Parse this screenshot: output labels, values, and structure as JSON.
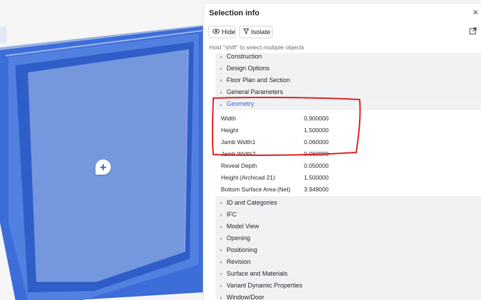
{
  "panel": {
    "title": "Selection info",
    "close_glyph": "×",
    "hide_label": "Hide",
    "isolate_label": "Isolate",
    "hint": "Hold \"shift\" to select multiple objects",
    "icons": {
      "hide": "eye-icon",
      "isolate": "filter-icon",
      "external": "external-link-icon",
      "close": "close-icon",
      "marker": "add-comment-icon"
    }
  },
  "groups_before": [
    {
      "label": "Construction"
    },
    {
      "label": "Design Options"
    },
    {
      "label": "Floor Plan and Section"
    },
    {
      "label": "General Parameters"
    }
  ],
  "geometry": {
    "label": "Geometry",
    "rows": [
      {
        "key": "Width",
        "value": "0.900000"
      },
      {
        "key": "Height",
        "value": "1.500000"
      },
      {
        "key": "Jamb Width1",
        "value": "0.060000"
      },
      {
        "key": "Jamb Width2",
        "value": "0.060000"
      },
      {
        "key": "Reveal Depth",
        "value": "0.050000"
      },
      {
        "key": "Height (Archicad 21)",
        "value": "1.500000"
      },
      {
        "key": "Bottom Surface Area (Net)",
        "value": "3.949000"
      }
    ]
  },
  "groups_after": [
    {
      "label": "ID and Categories"
    },
    {
      "label": "IFC"
    },
    {
      "label": "Model View"
    },
    {
      "label": "Opening"
    },
    {
      "label": "Positioning"
    },
    {
      "label": "Revision"
    },
    {
      "label": "Surface and Materials"
    },
    {
      "label": "Variant Dynamic Properties"
    },
    {
      "label": "Window/Door"
    }
  ],
  "colors": {
    "accent": "#3b63d6",
    "frame": "#3e6fd8",
    "glass": "#7597de",
    "annotation": "#e01e1e"
  }
}
